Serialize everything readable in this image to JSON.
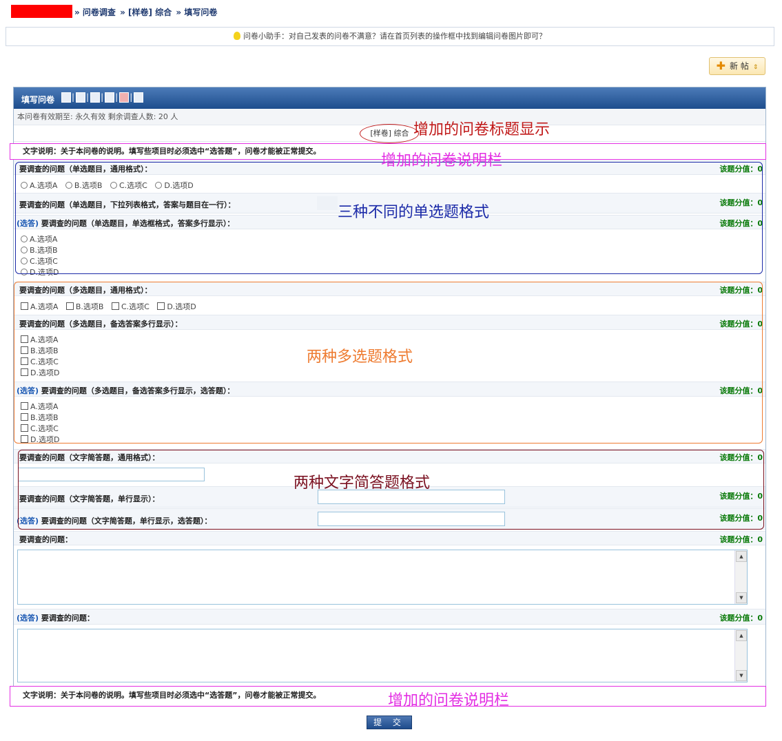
{
  "breadcrumb": {
    "items": [
      "» 问卷调查",
      "» [样卷] 综合",
      "» 填写问卷"
    ]
  },
  "helper": {
    "text": "问卷小助手：对自己发表的问卷不满意？请在首页列表的操作框中找到编辑问卷图片即可？"
  },
  "toolbar": {
    "new_post_label": "新 帖"
  },
  "survey": {
    "header_title": "填写问卷",
    "validity": "本问卷有效期至: 永久有效  剩余调查人数: 20 人",
    "title_tag": "[样卷]",
    "title_text": "综合",
    "description": "文字说明：关于本问卷的说明。填写些项目时必须选中“选答题”，问卷才能被正常提交。",
    "optional_tag": "(选答)",
    "score_label": "该题分值：0",
    "submit_label": "提 交"
  },
  "questions": {
    "q1": "要调查的问题（单选题目，通用格式）：",
    "q2": "要调查的问题（单选题目，下拉列表格式，答案与题目在一行）：",
    "q3": "要调查的问题（单选题目，单选框格式，答案多行显示）：",
    "q4": "要调查的问题（多选题目，通用格式）：",
    "q5": "要调查的问题（多选题目，备选答案多行显示）：",
    "q6": "要调查的问题（多选题目，备选答案多行显示，选答题）：",
    "q7": "要调查的问题（文字简答题，通用格式）：",
    "q8": "要调查的问题（文字简答题，单行显示）：",
    "q9": "要调查的问题（文字简答题，单行显示，选答题）：",
    "q10": "要调查的问题：",
    "q11": "要调查的问题："
  },
  "options": {
    "a": "A.选项A",
    "b": "B.选项B",
    "c": "C.选项C",
    "d": "D.选项D"
  },
  "annotations": {
    "title_note": "增加的问卷标题显示",
    "desc_note": "增加的问卷说明栏",
    "single_note": "三种不同的单选题格式",
    "multi_note": "两种多选题格式",
    "text_note": "两种文字简答题格式",
    "desc_note_bottom": "增加的问卷说明栏"
  },
  "colors": {
    "header_blue": "#1d4d8d",
    "score_green": "#0a7a0a",
    "annotation_red": "#c01818",
    "annotation_magenta": "#e32fe3",
    "annotation_navy": "#1b2aa8",
    "annotation_orange": "#ee7b30",
    "annotation_maroon": "#7a1020"
  }
}
